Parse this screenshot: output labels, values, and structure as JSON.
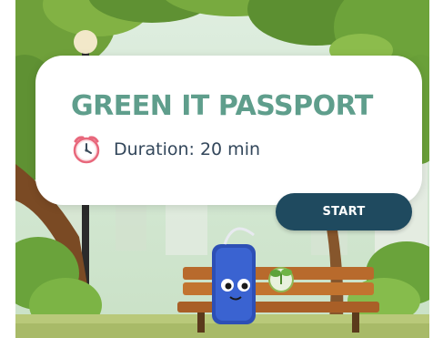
{
  "card": {
    "title": "GREEN IT PASSPORT",
    "duration_label": "Duration: 20 min",
    "clock_icon": "alarm-clock-icon"
  },
  "actions": {
    "start_label": "START"
  },
  "colors": {
    "title": "#5f9e8c",
    "button_bg": "#1f4a5f",
    "clock": "#e8687c"
  }
}
